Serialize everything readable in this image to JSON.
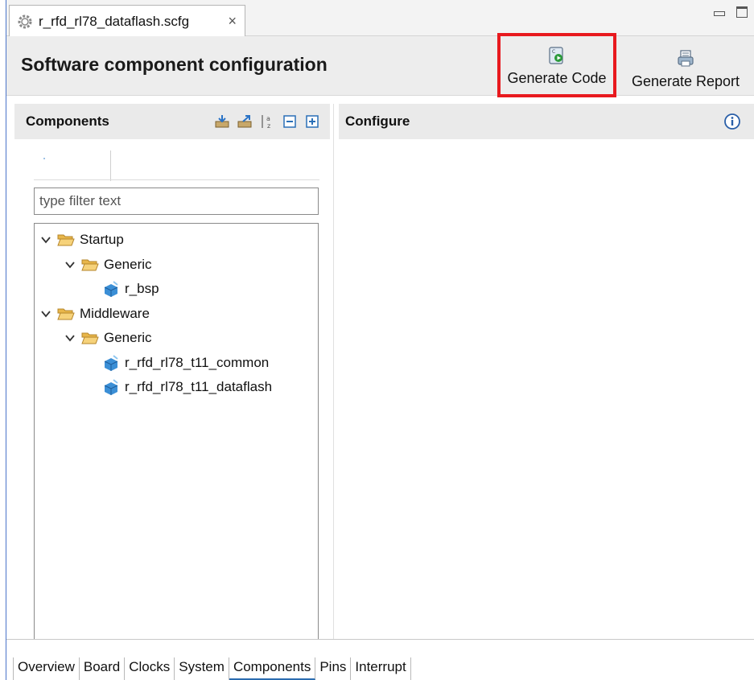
{
  "tab": {
    "title": "r_rfd_rl78_dataflash.scfg",
    "close_glyph": "×"
  },
  "header": {
    "title": "Software component configuration",
    "generate_code_label": "Generate Code",
    "generate_report_label": "Generate Report",
    "highlight_color": "#e8191e"
  },
  "components": {
    "title": "Components",
    "filter_placeholder": "type filter text",
    "tree": [
      {
        "label": "Startup",
        "type": "folder",
        "level": 0,
        "expanded": true
      },
      {
        "label": "Generic",
        "type": "folder",
        "level": 1,
        "expanded": true
      },
      {
        "label": "r_bsp",
        "type": "component",
        "level": 2
      },
      {
        "label": "Middleware",
        "type": "folder",
        "level": 0,
        "expanded": true
      },
      {
        "label": "Generic",
        "type": "folder",
        "level": 1,
        "expanded": true
      },
      {
        "label": "r_rfd_rl78_t11_common",
        "type": "component",
        "level": 2
      },
      {
        "label": "r_rfd_rl78_t11_dataflash",
        "type": "component",
        "level": 2
      }
    ]
  },
  "configure": {
    "title": "Configure"
  },
  "bottom_tabs": [
    {
      "label": "Overview",
      "active": false
    },
    {
      "label": "Board",
      "active": false
    },
    {
      "label": "Clocks",
      "active": false
    },
    {
      "label": "System",
      "active": false
    },
    {
      "label": "Components",
      "active": true
    },
    {
      "label": "Pins",
      "active": false
    },
    {
      "label": "Interrupt",
      "active": false
    }
  ],
  "icons": {
    "tab": "gear-icon",
    "generate_code": "generate-code-icon",
    "generate_report": "generate-report-icon",
    "info": "info-icon",
    "folder": "folder-open-icon",
    "component": "component-cube-icon"
  }
}
